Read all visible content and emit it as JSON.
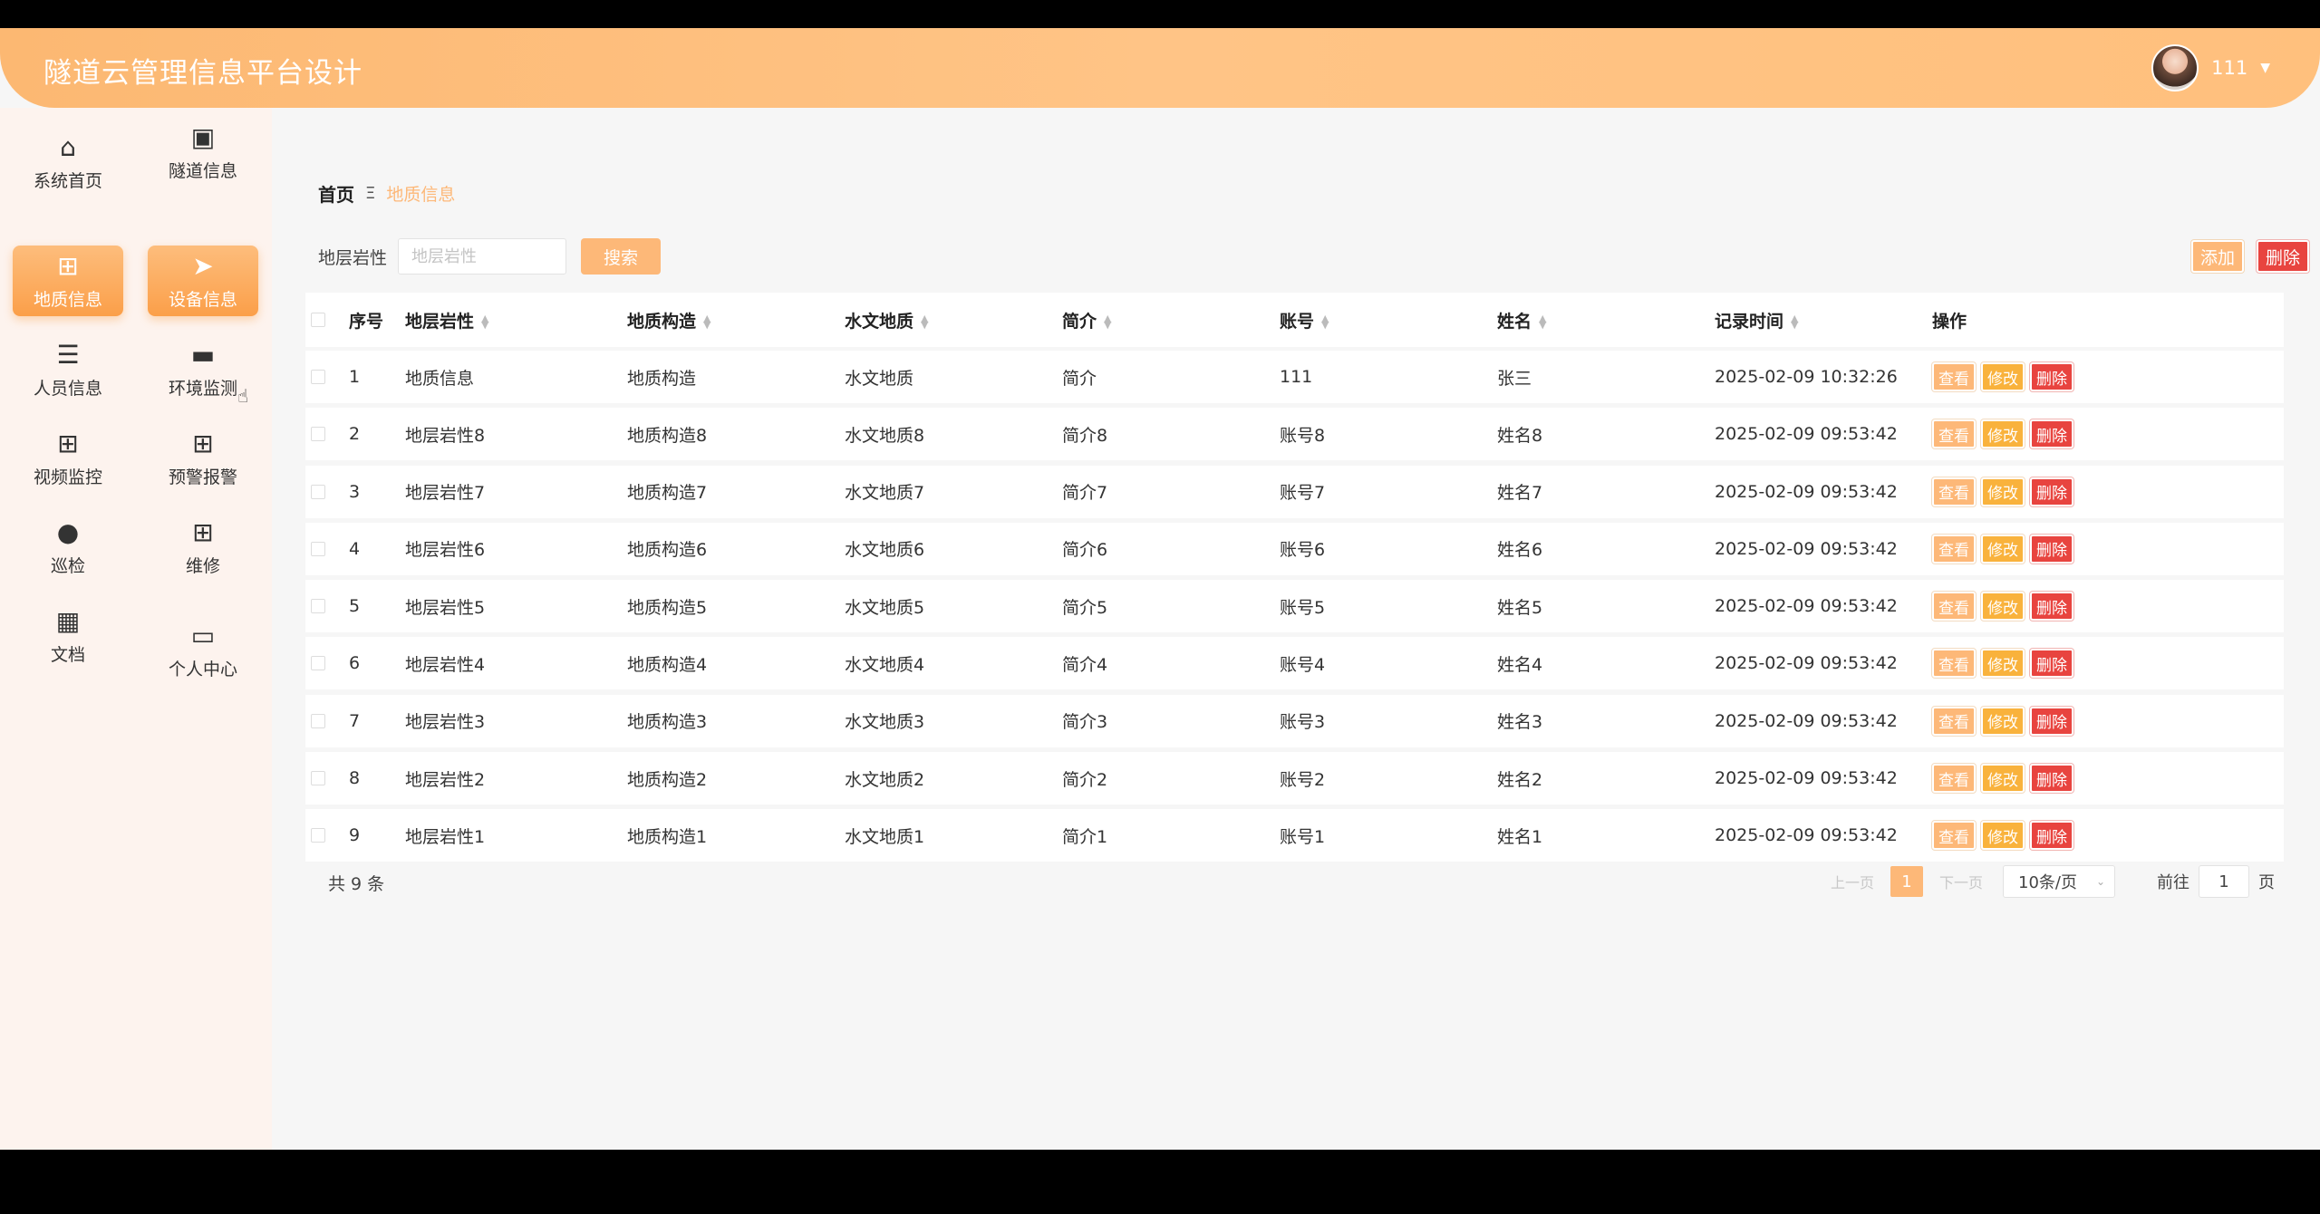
{
  "header": {
    "title": "隧道云管理信息平台设计",
    "username": "111"
  },
  "sidebar": {
    "items": [
      {
        "label": "系统首页",
        "icon": "home-icon"
      },
      {
        "label": "隧道信息",
        "icon": "message-icon"
      },
      {
        "label": "地质信息",
        "icon": "grid-icon",
        "active": true
      },
      {
        "label": "设备信息",
        "icon": "send-icon",
        "active": true
      },
      {
        "label": "人员信息",
        "icon": "list-icon"
      },
      {
        "label": "环境监测",
        "icon": "monitor-icon"
      },
      {
        "label": "视频监控",
        "icon": "grid-icon"
      },
      {
        "label": "预警报警",
        "icon": "grid-icon"
      },
      {
        "label": "巡检",
        "icon": "bulb-icon"
      },
      {
        "label": "维修",
        "icon": "grid-icon"
      },
      {
        "label": "文档",
        "icon": "apps-icon"
      },
      {
        "label": "个人中心",
        "icon": "card-icon"
      }
    ]
  },
  "breadcrumb": {
    "home": "首页",
    "separator": "Ξ",
    "current": "地质信息"
  },
  "search": {
    "label": "地层岩性",
    "placeholder": "地层岩性",
    "button": "搜索"
  },
  "actions": {
    "add": "添加",
    "delete": "删除"
  },
  "table": {
    "headers": [
      "序号",
      "地层岩性",
      "地质构造",
      "水文地质",
      "简介",
      "账号",
      "姓名",
      "记录时间",
      "操作"
    ],
    "rows": [
      [
        "1",
        "地质信息",
        "地质构造",
        "水文地质",
        "简介",
        "111",
        "张三",
        "2025-02-09 10:32:26"
      ],
      [
        "2",
        "地层岩性8",
        "地质构造8",
        "水文地质8",
        "简介8",
        "账号8",
        "姓名8",
        "2025-02-09 09:53:42"
      ],
      [
        "3",
        "地层岩性7",
        "地质构造7",
        "水文地质7",
        "简介7",
        "账号7",
        "姓名7",
        "2025-02-09 09:53:42"
      ],
      [
        "4",
        "地层岩性6",
        "地质构造6",
        "水文地质6",
        "简介6",
        "账号6",
        "姓名6",
        "2025-02-09 09:53:42"
      ],
      [
        "5",
        "地层岩性5",
        "地质构造5",
        "水文地质5",
        "简介5",
        "账号5",
        "姓名5",
        "2025-02-09 09:53:42"
      ],
      [
        "6",
        "地层岩性4",
        "地质构造4",
        "水文地质4",
        "简介4",
        "账号4",
        "姓名4",
        "2025-02-09 09:53:42"
      ],
      [
        "7",
        "地层岩性3",
        "地质构造3",
        "水文地质3",
        "简介3",
        "账号3",
        "姓名3",
        "2025-02-09 09:53:42"
      ],
      [
        "8",
        "地层岩性2",
        "地质构造2",
        "水文地质2",
        "简介2",
        "账号2",
        "姓名2",
        "2025-02-09 09:53:42"
      ],
      [
        "9",
        "地层岩性1",
        "地质构造1",
        "水文地质1",
        "简介1",
        "账号1",
        "姓名1",
        "2025-02-09 09:53:42"
      ]
    ],
    "row_actions": {
      "view": "查看",
      "edit": "修改",
      "delete": "删除"
    }
  },
  "pagination": {
    "total_text": "共 9 条",
    "prev": "上一页",
    "current_page": "1",
    "next": "下一页",
    "page_size": "10条/页",
    "goto_label": "前往",
    "goto_value": "1",
    "page_suffix": "页"
  },
  "colors": {
    "accent": "#fdb878",
    "header_gradient_start": "#fcb872",
    "danger": "#e8443f",
    "sidebar_bg": "#fdf3ee"
  }
}
